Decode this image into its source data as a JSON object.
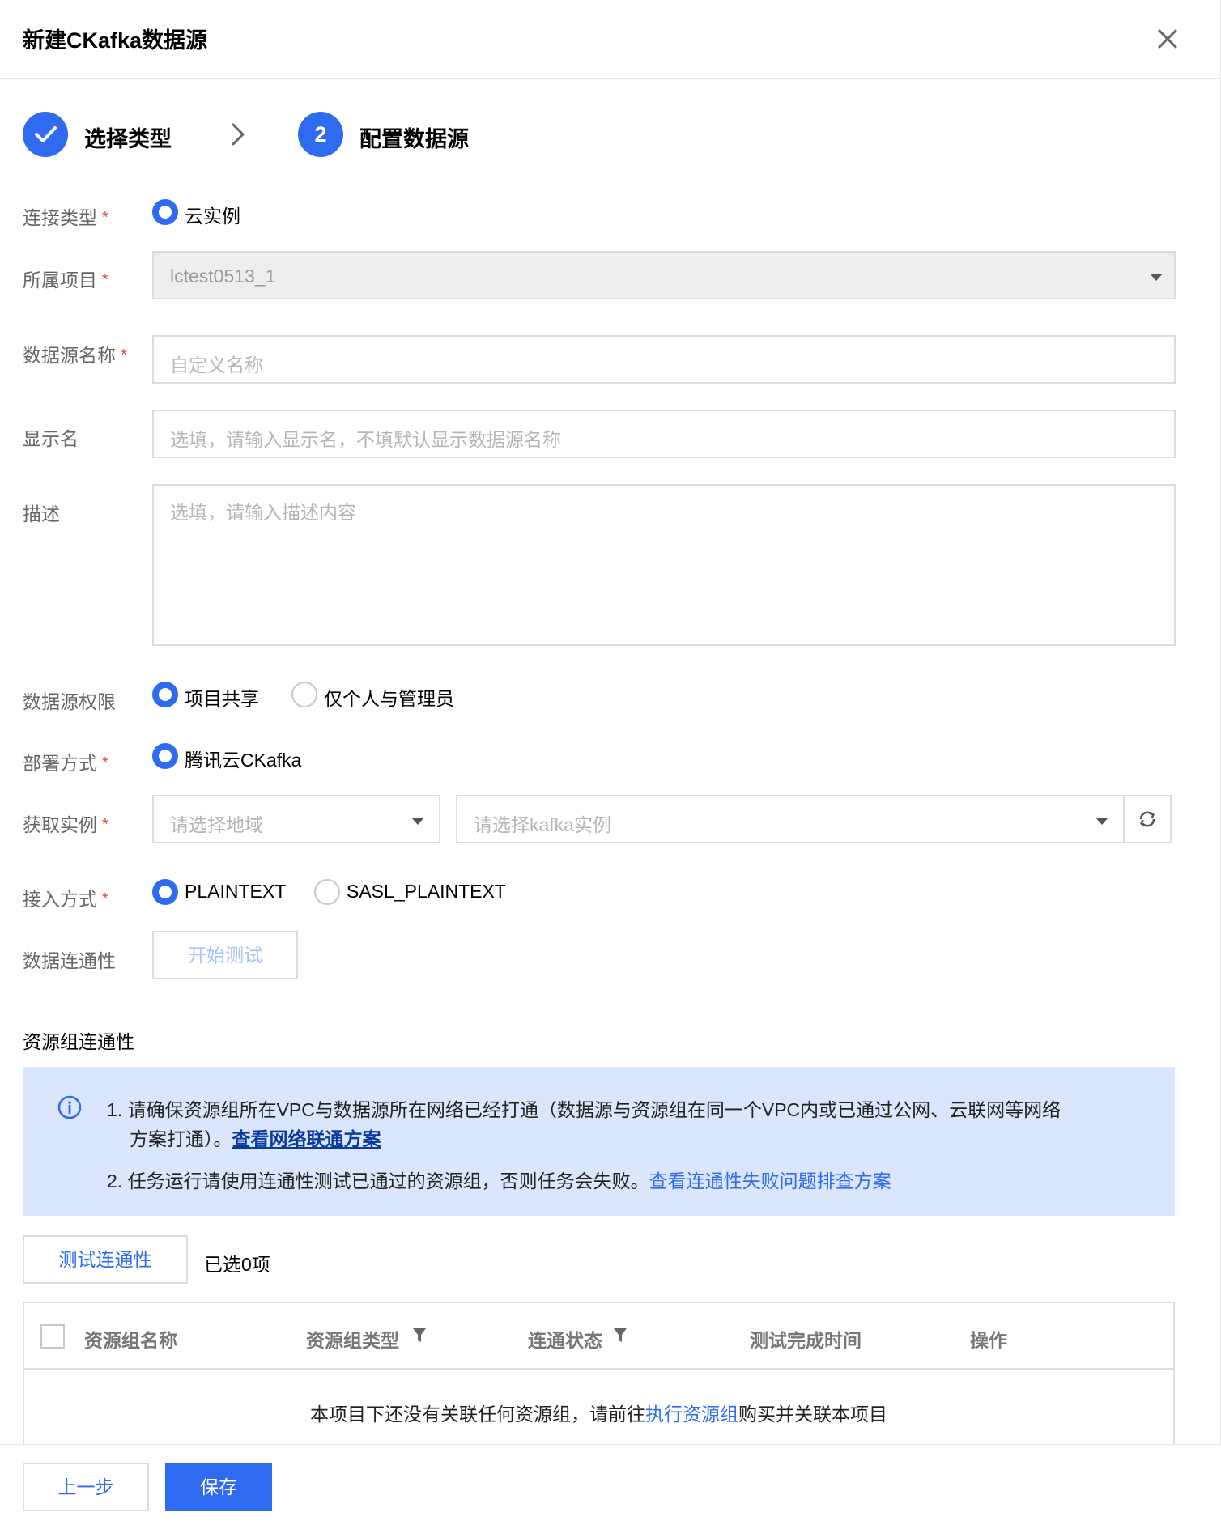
{
  "dialog": {
    "title": "新建CKafka数据源",
    "close_icon": "close-icon"
  },
  "steps": [
    {
      "label": "选择类型",
      "state": "done"
    },
    {
      "number": "2",
      "label": "配置数据源",
      "state": "active"
    }
  ],
  "form": {
    "connection_type": {
      "label": "连接类型",
      "option": "云实例"
    },
    "project": {
      "label": "所属项目",
      "value": "lctest0513_1"
    },
    "datasource_name": {
      "label": "数据源名称",
      "placeholder": "自定义名称"
    },
    "display_name": {
      "label": "显示名",
      "placeholder": "选填，请输入显示名，不填默认显示数据源名称"
    },
    "description": {
      "label": "描述",
      "placeholder": "选填，请输入描述内容"
    },
    "permission": {
      "label": "数据源权限",
      "options": [
        "项目共享",
        "仅个人与管理员"
      ]
    },
    "deployment": {
      "label": "部署方式",
      "option": "腾讯云CKafka"
    },
    "instance": {
      "label": "获取实例",
      "region_placeholder": "请选择地域",
      "instance_placeholder": "请选择kafka实例"
    },
    "access_mode": {
      "label": "接入方式",
      "options": [
        "PLAINTEXT",
        "SASL_PLAINTEXT"
      ]
    },
    "connectivity": {
      "label": "数据连通性",
      "button": "开始测试"
    }
  },
  "resource_group": {
    "title": "资源组连通性",
    "notice": {
      "line1": "1. 请确保资源组所在VPC与数据源所在网络已经打通（数据源与资源组在同一个VPC内或已通过公网、云联网等网络",
      "line2": "方案打通）。",
      "line2_link": "查看网络联通方案",
      "line3": "2. 任务运行请使用连通性测试已通过的资源组，否则任务会失败。",
      "line3_link": "查看连通性失败问题排查方案"
    },
    "test_button": "测试连通性",
    "selected_count": "已选0项",
    "table": {
      "columns": [
        "资源组名称",
        "资源组类型",
        "连通状态",
        "测试完成时间",
        "操作"
      ],
      "empty_text_before": "本项目下还没有关联任何资源组，请前往",
      "empty_link": "执行资源组",
      "empty_text_after": "购买并关联本项目"
    }
  },
  "footer": {
    "prev_button": "上一步",
    "save_button": "保存"
  },
  "colors": {
    "primary": "#2e6bf0",
    "required": "#e54545",
    "notice_bg": "#d9e6fc"
  }
}
